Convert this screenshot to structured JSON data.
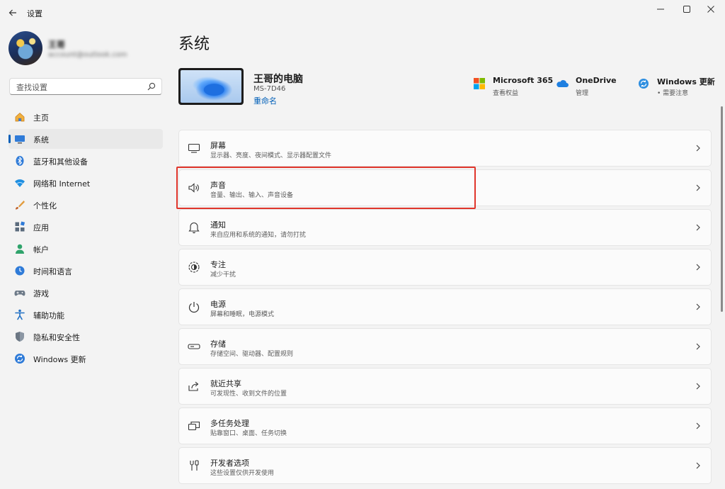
{
  "window": {
    "app_title": "设置"
  },
  "profile": {
    "name": "王哥",
    "email": "account@outlook.com"
  },
  "search": {
    "placeholder": "查找设置"
  },
  "sidebar": {
    "items": [
      {
        "label": "主页",
        "icon": "home-icon"
      },
      {
        "label": "系统",
        "icon": "system-icon",
        "selected": true
      },
      {
        "label": "蓝牙和其他设备",
        "icon": "bluetooth-icon"
      },
      {
        "label": "网络和 Internet",
        "icon": "wifi-icon"
      },
      {
        "label": "个性化",
        "icon": "brush-icon"
      },
      {
        "label": "应用",
        "icon": "apps-icon"
      },
      {
        "label": "帐户",
        "icon": "person-icon"
      },
      {
        "label": "时间和语言",
        "icon": "globe-clock-icon"
      },
      {
        "label": "游戏",
        "icon": "gamepad-icon"
      },
      {
        "label": "辅助功能",
        "icon": "accessibility-icon"
      },
      {
        "label": "隐私和安全性",
        "icon": "shield-icon"
      },
      {
        "label": "Windows 更新",
        "icon": "update-icon"
      }
    ]
  },
  "main": {
    "page_title": "系统",
    "device": {
      "name": "王哥的电脑",
      "model": "MS-7D46",
      "rename": "重命名"
    },
    "quick": [
      {
        "title": "Microsoft 365",
        "sub": "查看权益",
        "icon": "microsoft-logo-icon"
      },
      {
        "title": "OneDrive",
        "sub": "管理",
        "icon": "cloud-icon"
      },
      {
        "title": "Windows 更新",
        "sub": "• 需要注意",
        "icon": "update-icon"
      }
    ],
    "cards": [
      {
        "title": "屏幕",
        "sub": "显示器、亮度、夜间模式、显示器配置文件",
        "icon": "monitor-icon"
      },
      {
        "title": "声音",
        "sub": "音量、输出、输入、声音设备",
        "icon": "speaker-icon"
      },
      {
        "title": "通知",
        "sub": "来自应用和系统的通知，请勿打扰",
        "icon": "bell-icon"
      },
      {
        "title": "专注",
        "sub": "减少干扰",
        "icon": "focus-icon"
      },
      {
        "title": "电源",
        "sub": "屏幕和睡眠，电源模式",
        "icon": "power-icon"
      },
      {
        "title": "存储",
        "sub": "存储空间、驱动器、配置规则",
        "icon": "storage-icon"
      },
      {
        "title": "就近共享",
        "sub": "可发现性、收到文件的位置",
        "icon": "share-icon"
      },
      {
        "title": "多任务处理",
        "sub": "贴靠窗口、桌面、任务切换",
        "icon": "multitask-icon"
      },
      {
        "title": "开发者选项",
        "sub": "这些设置仅供开发使用",
        "icon": "developer-tools-icon"
      }
    ]
  },
  "colors": {
    "accent": "#005fb8",
    "highlight": "#e0352b",
    "background": "#f3f3f3"
  }
}
